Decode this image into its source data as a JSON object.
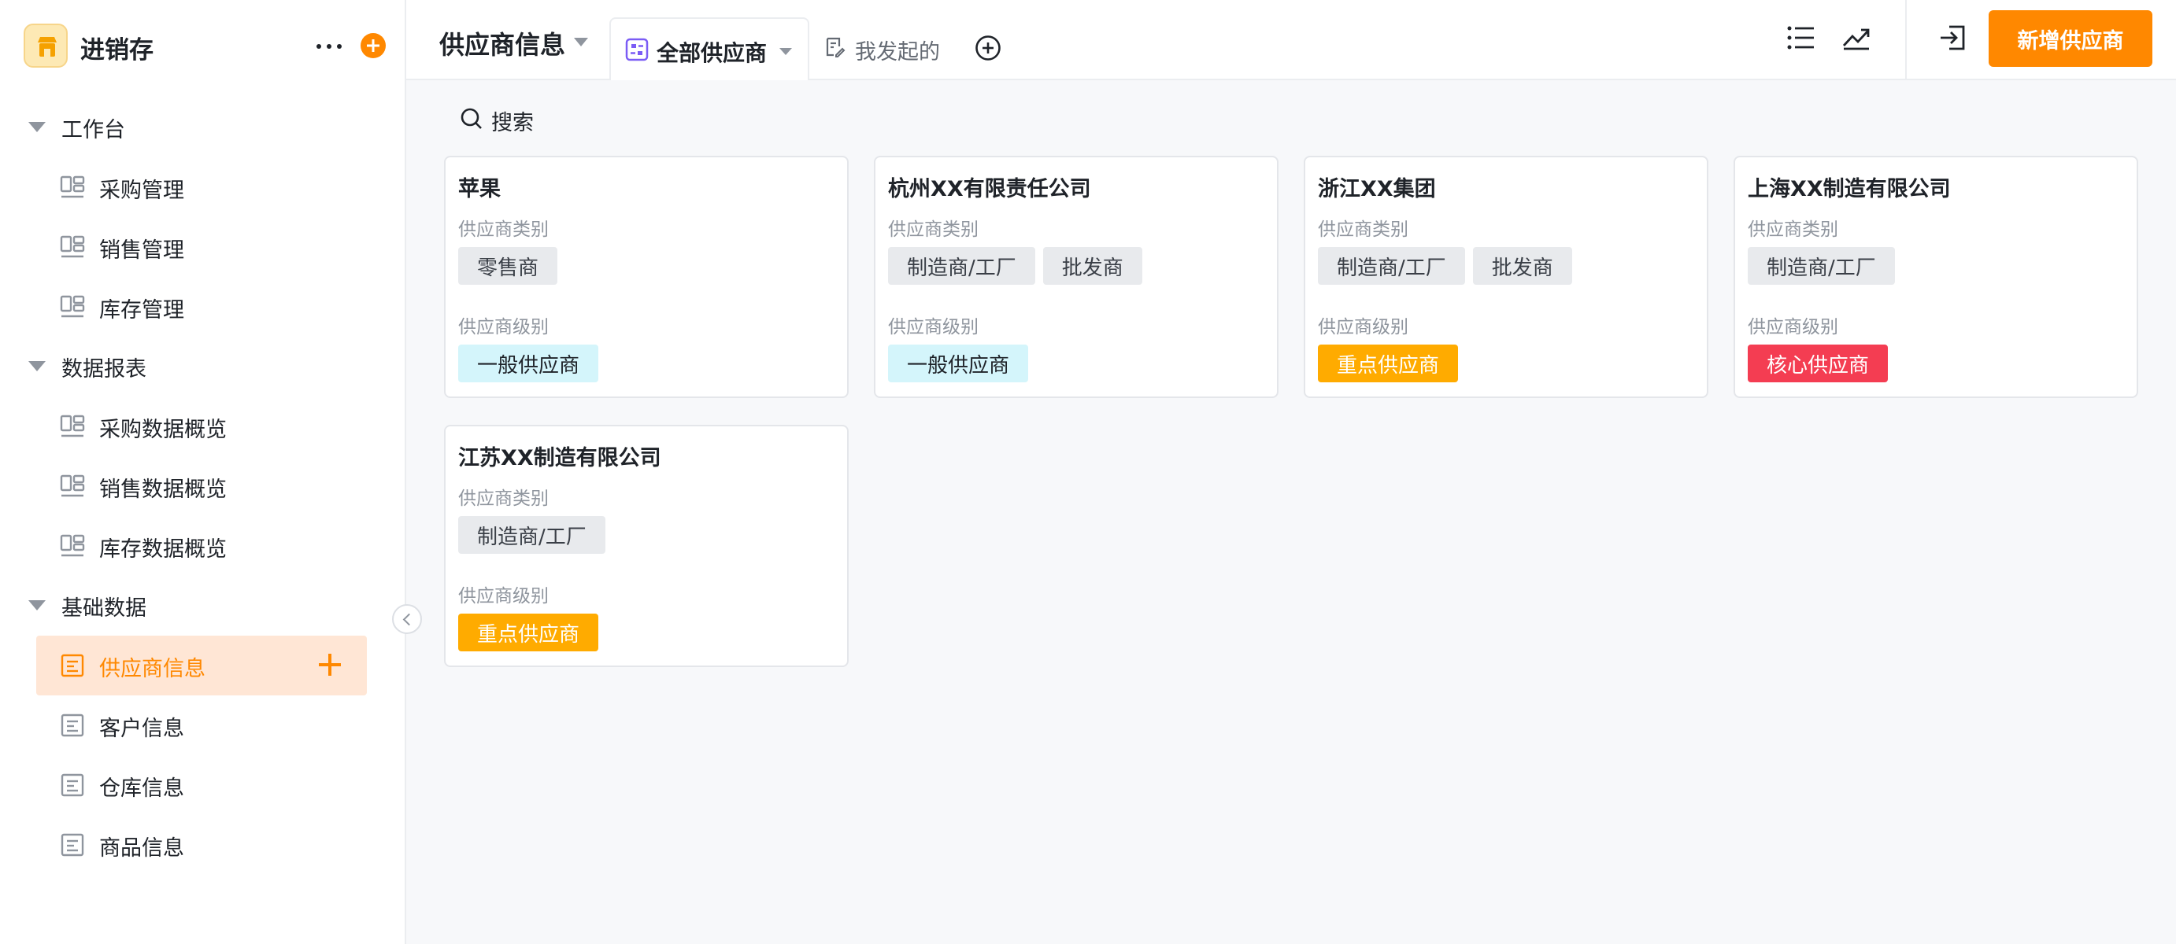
{
  "app": {
    "name": "进销存"
  },
  "colors": {
    "accent": "#ff8800",
    "tag_general": "#d4f5fb",
    "tag_key": "#ffab00",
    "tag_core": "#f43d52",
    "tag_category": "#e8eaed"
  },
  "sidebar": {
    "groups": [
      {
        "label": "工作台",
        "items": [
          {
            "label": "采购管理"
          },
          {
            "label": "销售管理"
          },
          {
            "label": "库存管理"
          }
        ]
      },
      {
        "label": "数据报表",
        "items": [
          {
            "label": "采购数据概览"
          },
          {
            "label": "销售数据概览"
          },
          {
            "label": "库存数据概览"
          }
        ]
      },
      {
        "label": "基础数据",
        "items": [
          {
            "label": "供应商信息",
            "active": true
          },
          {
            "label": "客户信息"
          },
          {
            "label": "仓库信息"
          },
          {
            "label": "商品信息"
          }
        ]
      }
    ]
  },
  "header": {
    "title": "供应商信息",
    "tabs": [
      {
        "label": "全部供应商",
        "active": true
      },
      {
        "label": "我发起的"
      }
    ],
    "add_button_label": "新增供应商",
    "icons": [
      "list-icon",
      "trend-icon",
      "exit-icon"
    ]
  },
  "main": {
    "search_label": "搜索",
    "category_label": "供应商类别",
    "level_label": "供应商级别",
    "cards": [
      {
        "name": "苹果",
        "categories": [
          "零售商"
        ],
        "level": "一般供应商",
        "level_style": "cyan"
      },
      {
        "name": "杭州XX有限责任公司",
        "categories": [
          "制造商/工厂",
          "批发商"
        ],
        "level": "一般供应商",
        "level_style": "cyan"
      },
      {
        "name": "浙江XX集团",
        "categories": [
          "制造商/工厂",
          "批发商"
        ],
        "level": "重点供应商",
        "level_style": "orange"
      },
      {
        "name": "上海XX制造有限公司",
        "categories": [
          "制造商/工厂"
        ],
        "level": "核心供应商",
        "level_style": "red"
      },
      {
        "name": "江苏XX制造有限公司",
        "categories": [
          "制造商/工厂"
        ],
        "level": "重点供应商",
        "level_style": "orange"
      }
    ]
  }
}
